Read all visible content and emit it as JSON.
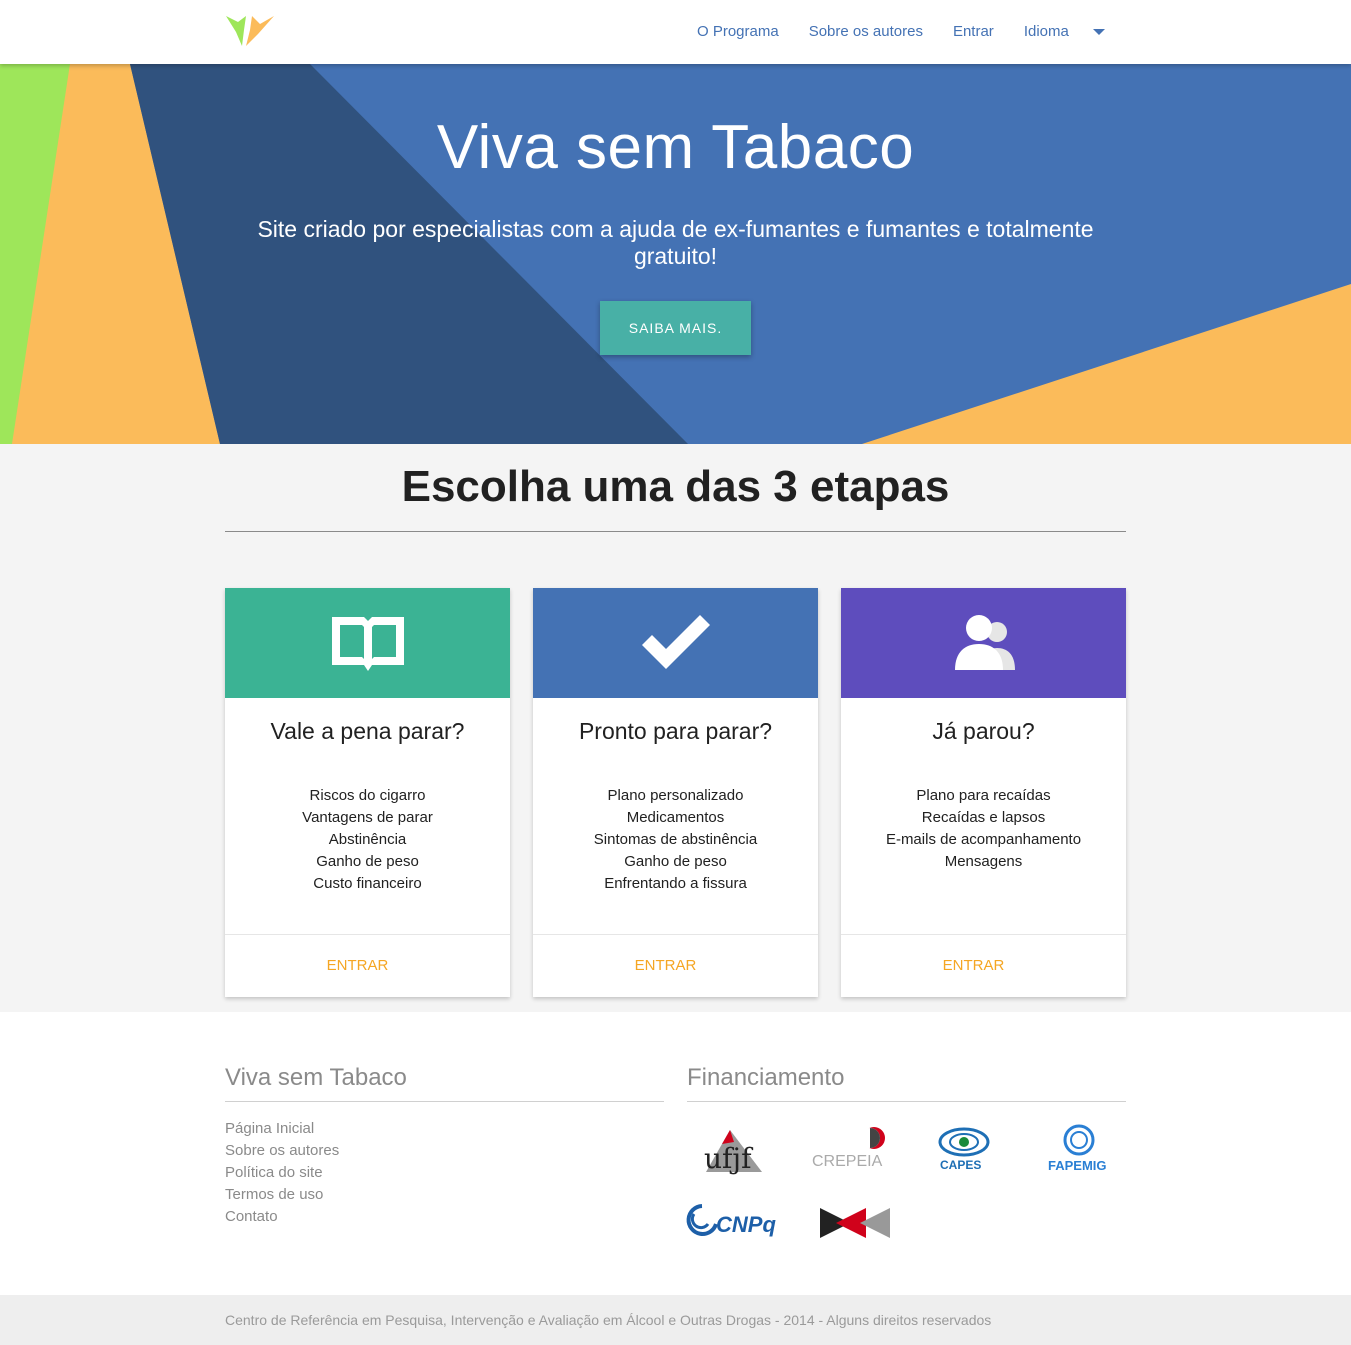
{
  "nav": {
    "links": [
      "O Programa",
      "Sobre os autores",
      "Entrar",
      "Idioma"
    ]
  },
  "hero": {
    "title": "Viva sem Tabaco",
    "subtitle": "Site criado por especialistas com a ajuda de ex-fumantes e fumantes e totalmente gratuito!",
    "button": "SAIBA MAIS."
  },
  "section": {
    "title": "Escolha uma das 3 etapas"
  },
  "cards": [
    {
      "icon": "book-icon",
      "color": "#3bb394",
      "title": "Vale a pena parar?",
      "items": [
        "Riscos do cigarro",
        "Vantagens de parar",
        "Abstinência",
        "Ganho de peso",
        "Custo financeiro"
      ],
      "action": "ENTRAR"
    },
    {
      "icon": "checkmark-icon",
      "color": "#4472b4",
      "title": "Pronto para parar?",
      "items": [
        "Plano personalizado",
        "Medicamentos",
        "Sintomas de abstinência",
        "Ganho de peso",
        "Enfrentando a fissura"
      ],
      "action": "ENTRAR"
    },
    {
      "icon": "users-icon",
      "color": "#5e4dbd",
      "title": "Já parou?",
      "items": [
        "Plano para recaídas",
        "Recaídas e lapsos",
        "E-mails de acompanhamento",
        "Mensagens"
      ],
      "action": "ENTRAR"
    }
  ],
  "footer": {
    "site_title": "Viva sem Tabaco",
    "links": [
      "Página Inicial",
      "Sobre os autores",
      "Política do site",
      "Termos de uso",
      "Contato"
    ],
    "funding_title": "Financiamento",
    "sponsors": [
      "ufjf",
      "CREPEIA",
      "CAPES",
      "FAPEMIG",
      "CNPq"
    ],
    "copyright": "Centro de Referência em Pesquisa, Intervenção e Avaliação em Álcool e Outras Drogas - 2014 - Alguns direitos reservados"
  },
  "colors": {
    "accent": "#4472b4",
    "button": "#48b0a6",
    "action": "#f5a623",
    "hero_green": "#9ee65a",
    "hero_orange": "#fbbb5a",
    "hero_dark": "#30527e"
  }
}
